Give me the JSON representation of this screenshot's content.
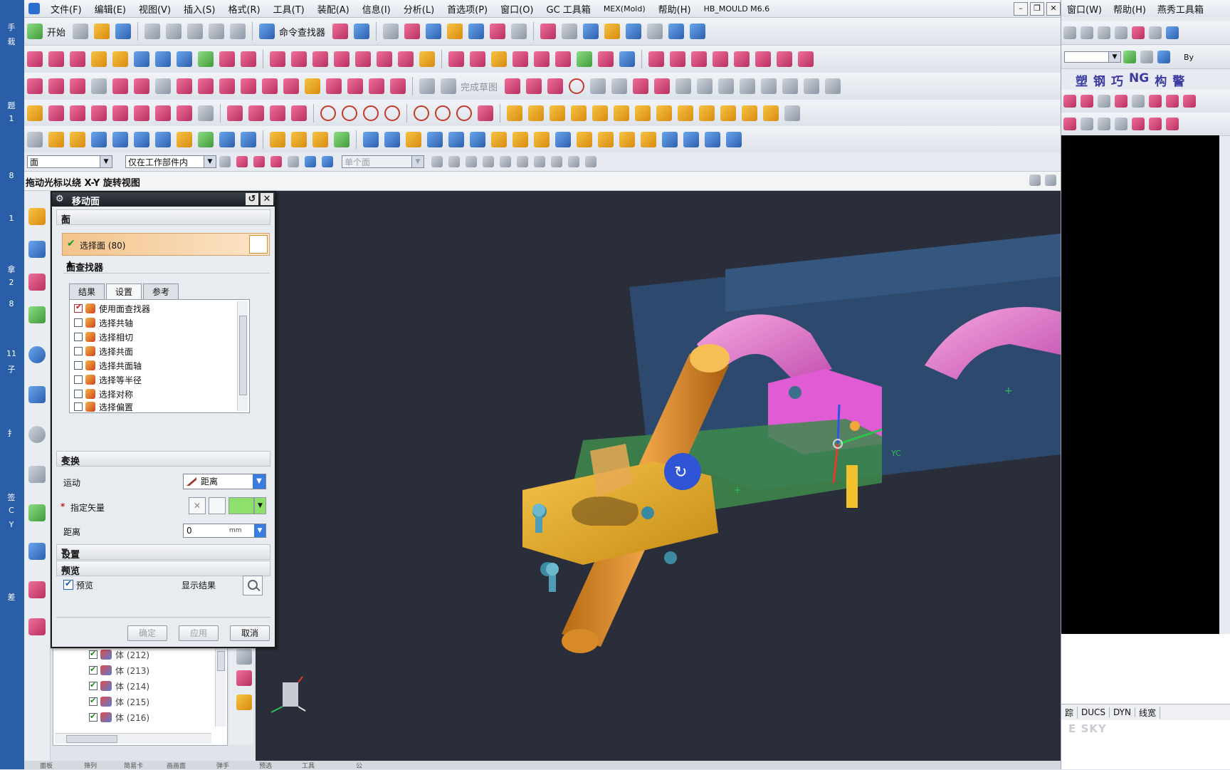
{
  "desktop_left": {
    "labels": [
      "手",
      "栽",
      "题",
      "1",
      "8",
      "1",
      "拿",
      "2",
      "8",
      "11",
      "子",
      "扌",
      "签",
      "C",
      "Y",
      "差"
    ]
  },
  "menubar": {
    "items": [
      "文件(F)",
      "编辑(E)",
      "视图(V)",
      "插入(S)",
      "格式(R)",
      "工具(T)",
      "装配(A)",
      "信息(I)",
      "分析(L)",
      "首选项(P)",
      "窗口(O)",
      "GC 工具箱",
      "MEX(Mold)",
      "帮助(H)",
      "HB_MOULD M6.6"
    ]
  },
  "toolbar": {
    "start_label": "开始",
    "command_finder_label": "命令查找器",
    "finish_sketch_label": "完成草图"
  },
  "selection_bar": {
    "filter": "面",
    "scope": "仅在工作部件内",
    "face_rule": "单个面"
  },
  "status": {
    "prompt": "拖动光标以绕 X-Y 旋转视图"
  },
  "dialog": {
    "title": "移动面",
    "face_section": "面",
    "select_face_label": "选择面 (80)",
    "face_finder_section": "面查找器",
    "tabs": [
      "结果",
      "设置",
      "参考"
    ],
    "finder_options": [
      {
        "label": "使用面查找器",
        "checked": true
      },
      {
        "label": "选择共轴",
        "checked": false
      },
      {
        "label": "选择相切",
        "checked": false
      },
      {
        "label": "选择共面",
        "checked": false
      },
      {
        "label": "选择共面轴",
        "checked": false
      },
      {
        "label": "选择等半径",
        "checked": false
      },
      {
        "label": "选择对称",
        "checked": false
      },
      {
        "label": "选择偏置",
        "checked": false
      }
    ],
    "transform_section": "变换",
    "motion_label": "运动",
    "motion_value": "距离",
    "vector_label": "指定矢量",
    "distance_label": "距离",
    "distance_value": "0",
    "distance_unit": "mm",
    "settings_section": "设置",
    "preview_section": "预览",
    "preview_label": "预览",
    "show_result_label": "显示结果",
    "ok_label": "确定",
    "apply_label": "应用",
    "cancel_label": "取消"
  },
  "navigator": {
    "rows": [
      {
        "label": "体 (212)"
      },
      {
        "label": "体 (213)"
      },
      {
        "label": "体 (214)"
      },
      {
        "label": "体 (215)"
      },
      {
        "label": "体 (216)"
      }
    ]
  },
  "graphics": {
    "axis_label": "YC"
  },
  "right_panel": {
    "menu": [
      "窗口(W)",
      "帮助(H)",
      "燕秀工具箱"
    ],
    "tool_label": "By",
    "cn_buttons": [
      "塑",
      "钢",
      "巧",
      "NG",
      "构",
      "警"
    ],
    "status_items": [
      "踪",
      "DUCS",
      "DYN",
      "线宽"
    ],
    "watermark": "E SKY"
  },
  "bottom_tabs": [
    "面板",
    "筛列",
    "简易卡",
    "画画面",
    "弹手",
    "预选",
    "工具",
    "公"
  ]
}
